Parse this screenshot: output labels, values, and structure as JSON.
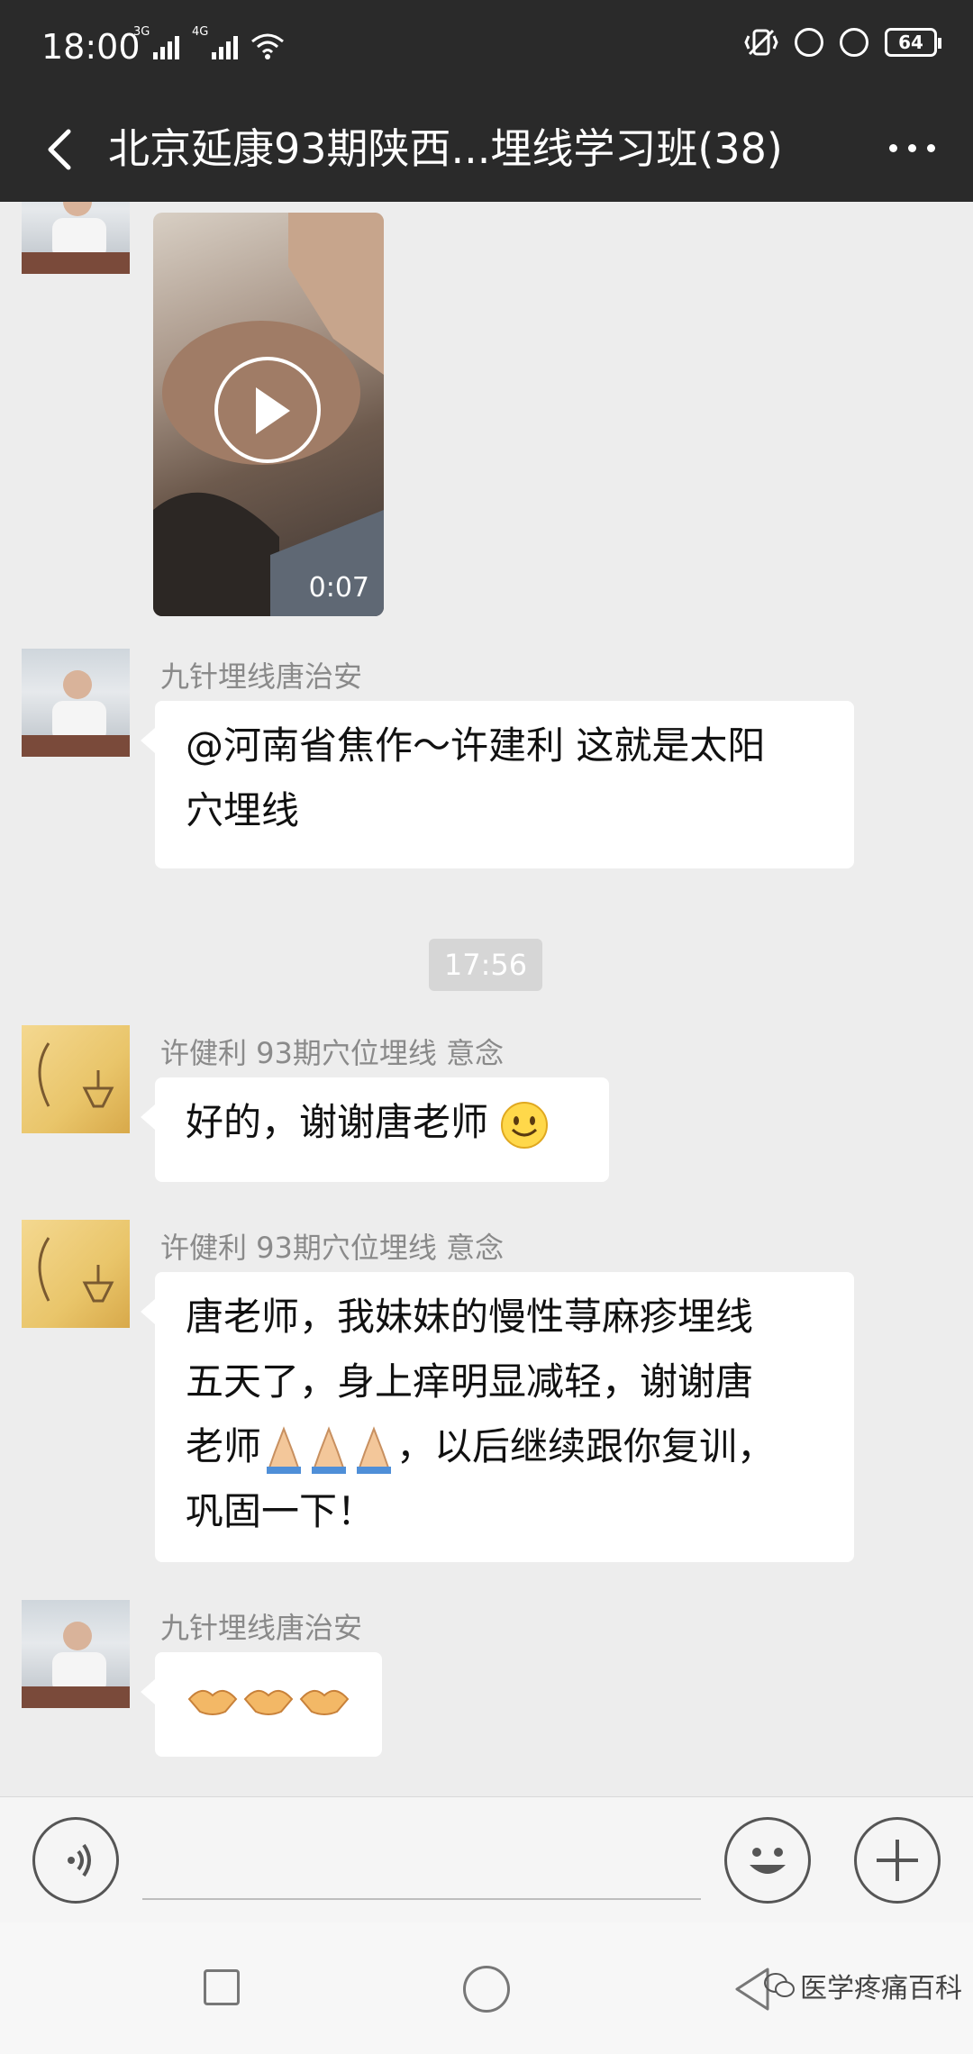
{
  "status": {
    "time": "18:00",
    "net1": "3G",
    "net2": "4G",
    "battery": "64"
  },
  "nav": {
    "title": "北京延康93期陕西...埋线学习班(38)"
  },
  "chat": {
    "video_duration": "0:07",
    "messages": [
      {
        "sender": "九针埋线唐治安",
        "lines": [
          "@河南省焦作～许建利  这就是太阳",
          "穴埋线"
        ]
      },
      {
        "sender": "许健利  93期穴位埋线   意念",
        "text": "好的，谢谢唐老师"
      },
      {
        "sender": "许健利  93期穴位埋线   意念",
        "lines": [
          "唐老师，我妹妹的慢性荨麻疹埋线",
          "五天了，身上痒明显减轻，谢谢唐",
          "，以后继续跟你复训，",
          "巩固一下！"
        ],
        "line3_prefix": "老师"
      },
      {
        "sender": "九针埋线唐治安",
        "emoji": "handshake-icon ×3"
      }
    ],
    "timestamp": "17:56"
  },
  "sysnav": {
    "watermark": "医学疼痛百科"
  },
  "colors": {
    "bar": "#2a2a2a",
    "chat_bg": "#ededed",
    "bubble": "#ffffff"
  }
}
